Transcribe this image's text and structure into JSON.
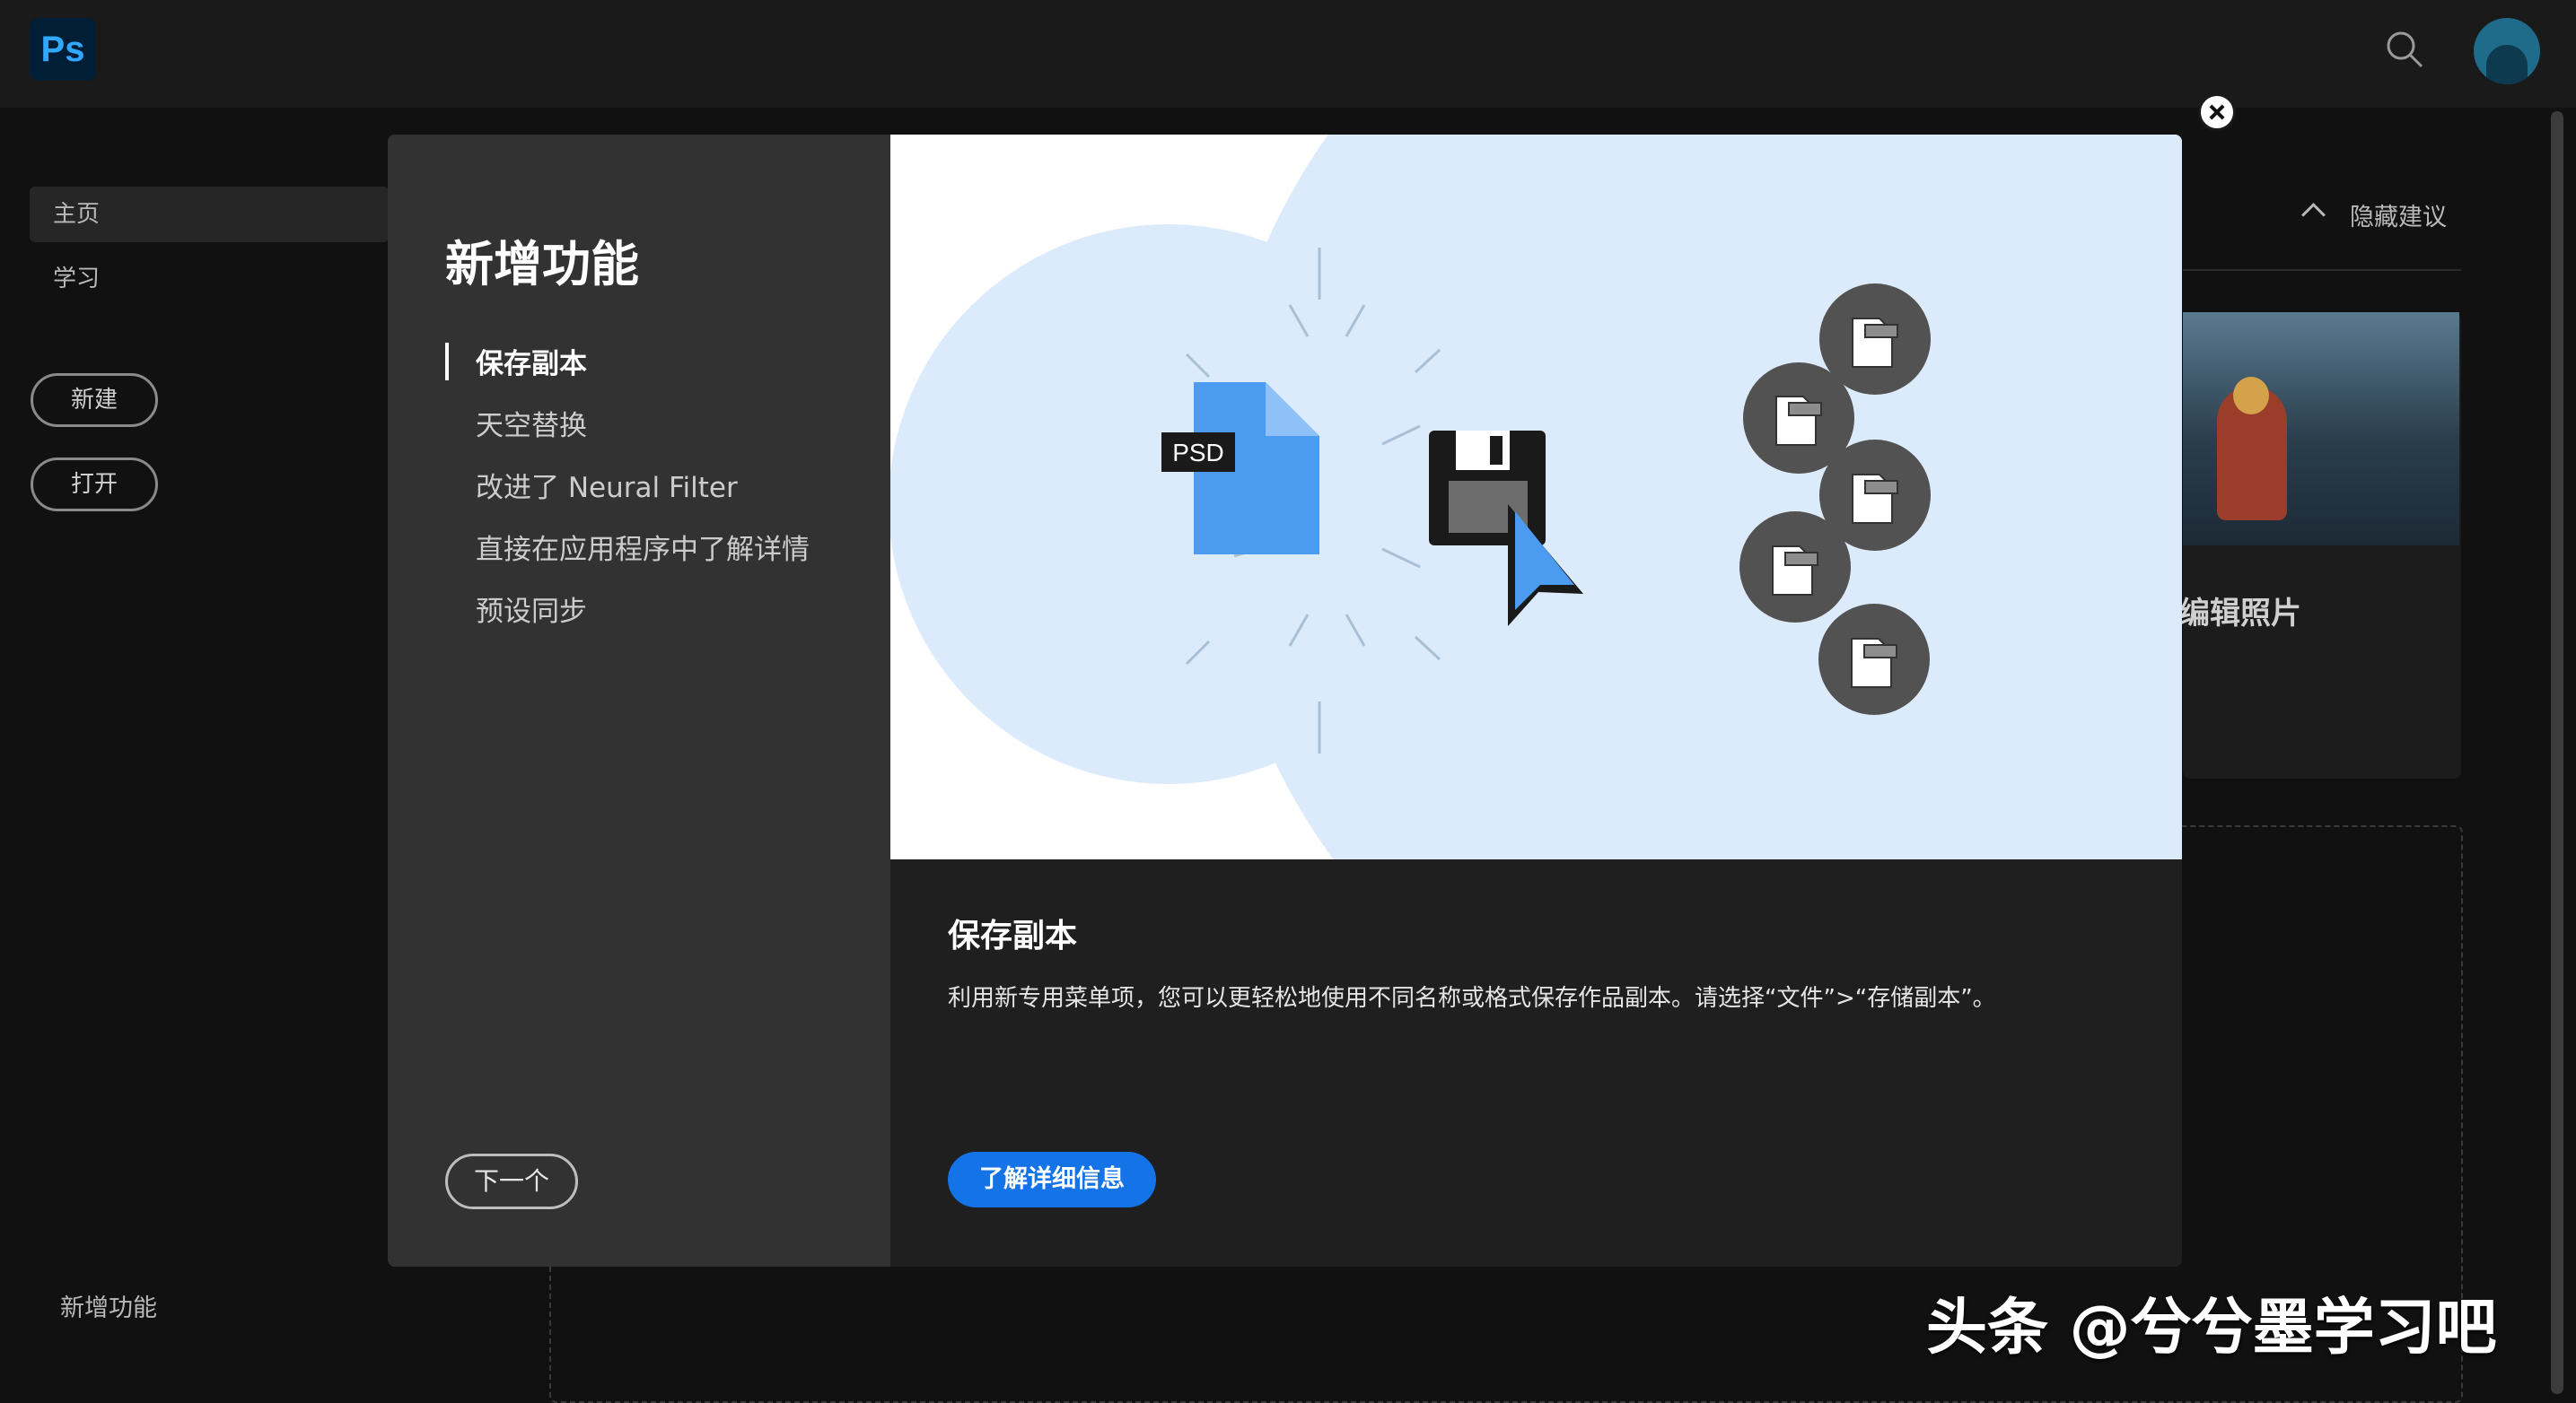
{
  "app": {
    "logo_text": "Ps"
  },
  "sidebar": {
    "items": [
      {
        "label": "主页"
      },
      {
        "label": "学习"
      }
    ],
    "new_button": "新建",
    "open_button": "打开",
    "whats_new": "新增功能"
  },
  "main": {
    "hide_suggestions": "隐藏建议",
    "card_title": "编辑照片"
  },
  "modal": {
    "title": "新增功能",
    "features": [
      {
        "label": "保存副本",
        "active": true
      },
      {
        "label": "天空替换",
        "active": false
      },
      {
        "label": "改进了 Neural Filter",
        "active": false
      },
      {
        "label": "直接在应用程序中了解详情",
        "active": false
      },
      {
        "label": "预设同步",
        "active": false
      }
    ],
    "next_button": "下一个",
    "hero_badge": "PSD",
    "detail_title": "保存副本",
    "detail_desc": "利用新专用菜单项，您可以更轻松地使用不同名称或格式保存作品副本。请选择“文件”>“存储副本”。",
    "learn_button": "了解详细信息"
  },
  "watermark": "头条 @兮兮墨学习吧",
  "colors": {
    "accent": "#1473e6",
    "psd_blue": "#4b9bf0",
    "hero_bg": "#dcebfb"
  }
}
